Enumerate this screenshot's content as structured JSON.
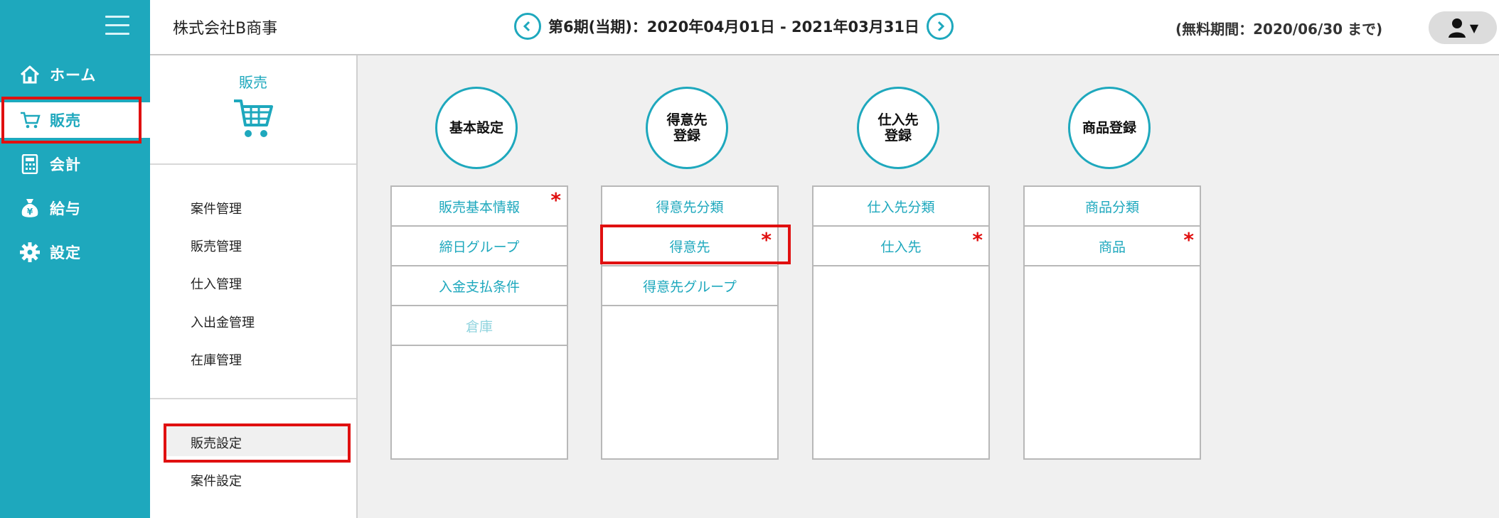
{
  "nav": {
    "items": [
      {
        "label": "ホーム",
        "icon": "home-icon"
      },
      {
        "label": "販売",
        "icon": "cart-icon"
      },
      {
        "label": "会計",
        "icon": "calculator-icon"
      },
      {
        "label": "給与",
        "icon": "money-bag-icon"
      },
      {
        "label": "設定",
        "icon": "gear-icon"
      }
    ]
  },
  "header": {
    "company": "株式会社B商事",
    "period": "第6期(当期)：2020年04月01日 - 2021年03月31日",
    "trial": "(無料期間：2020/06/30 まで)"
  },
  "subnav": {
    "title": "販売",
    "menu": [
      "案件管理",
      "販売管理",
      "仕入管理",
      "入出金管理",
      "在庫管理"
    ],
    "settings": [
      "販売設定",
      "案件設定"
    ]
  },
  "sections": [
    {
      "title_lines": [
        "基本設定"
      ],
      "items": [
        {
          "label": "販売基本情報",
          "required": true,
          "enabled": true
        },
        {
          "label": "締日グループ",
          "required": false,
          "enabled": true
        },
        {
          "label": "入金支払条件",
          "required": false,
          "enabled": true
        },
        {
          "label": "倉庫",
          "required": false,
          "enabled": false
        }
      ]
    },
    {
      "title_lines": [
        "得意先",
        "登録"
      ],
      "items": [
        {
          "label": "得意先分類",
          "required": false,
          "enabled": true
        },
        {
          "label": "得意先",
          "required": true,
          "enabled": true
        },
        {
          "label": "得意先グループ",
          "required": false,
          "enabled": true
        }
      ]
    },
    {
      "title_lines": [
        "仕入先",
        "登録"
      ],
      "items": [
        {
          "label": "仕入先分類",
          "required": false,
          "enabled": true
        },
        {
          "label": "仕入先",
          "required": true,
          "enabled": true
        }
      ]
    },
    {
      "title_lines": [
        "商品登録"
      ],
      "items": [
        {
          "label": "商品分類",
          "required": false,
          "enabled": true
        },
        {
          "label": "商品",
          "required": true,
          "enabled": true
        }
      ]
    }
  ],
  "required_mark": "*",
  "colors": {
    "accent": "#1ea8bd",
    "highlight": "#e01010",
    "required": "#e01010"
  }
}
